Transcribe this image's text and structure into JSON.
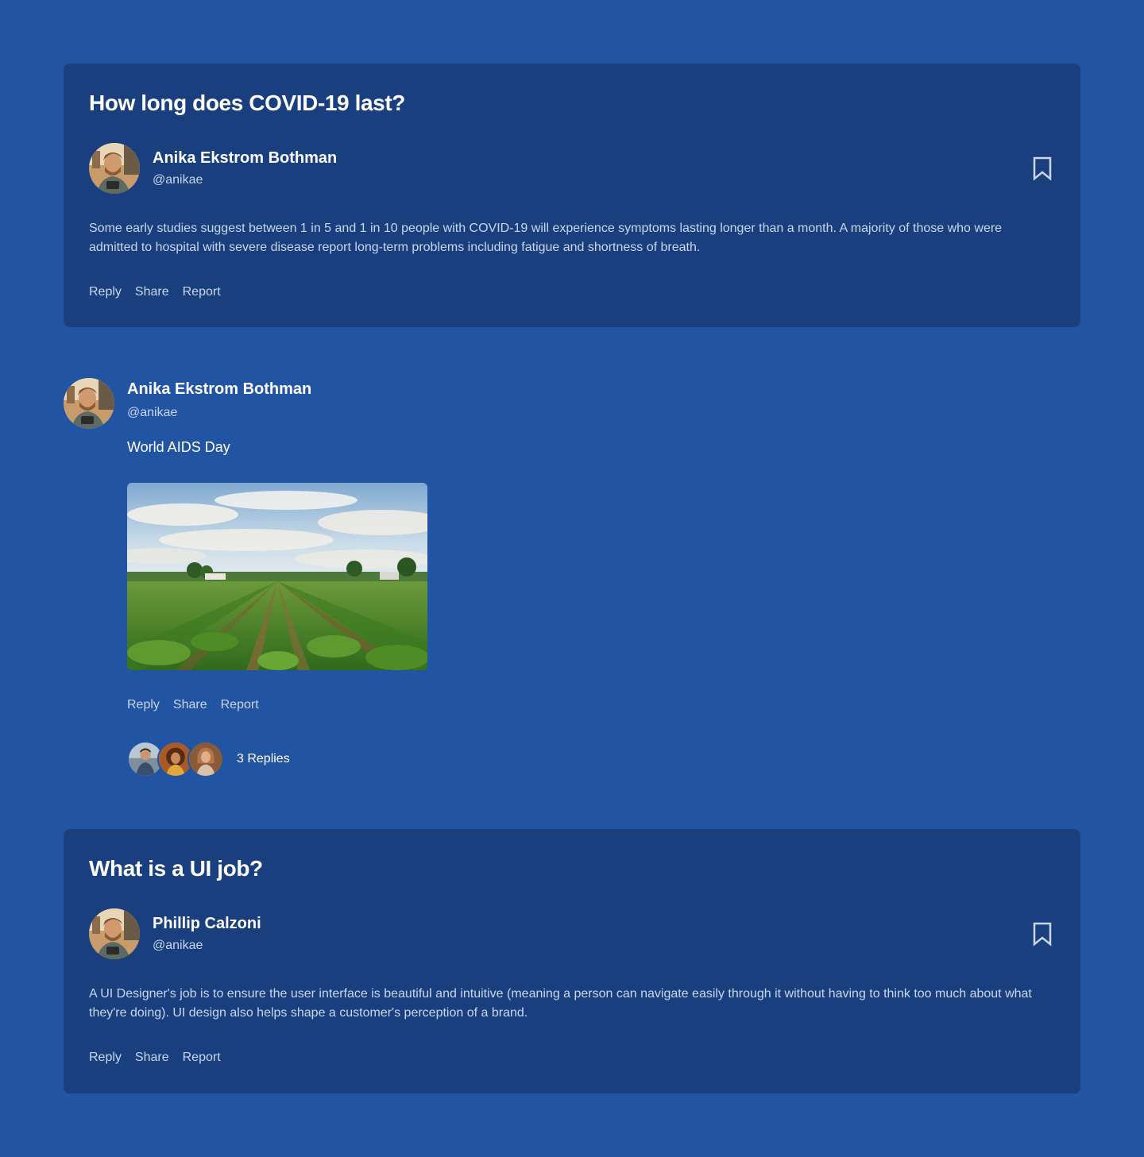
{
  "posts": [
    {
      "title": "How long does COVID-19 last?",
      "author": {
        "name": "Anika Ekstrom Bothman",
        "handle": "@anikae"
      },
      "body": "Some early studies suggest between 1 in 5 and 1 in 10 people with COVID-19 will experience symptoms lasting longer than a month. A majority of those who were admitted to hospital with severe disease report long-term problems including fatigue and shortness of breath.",
      "actions": [
        "Reply",
        "Share",
        "Report"
      ],
      "bookmark_icon": "bookmark-icon"
    },
    {
      "author": {
        "name": "Anika Ekstrom Bothman",
        "handle": "@anikae"
      },
      "text": "World AIDS Day",
      "image": "farm-field-landscape",
      "actions": [
        "Reply",
        "Share",
        "Report"
      ],
      "replies_label": "3 Replies"
    },
    {
      "title": "What is a UI job?",
      "author": {
        "name": "Phillip Calzoni",
        "handle": "@anikae"
      },
      "body": "A UI Designer's job is to ensure the user interface is beautiful and intuitive (meaning a person can navigate easily through it without having to think too much about what they're doing). UI design also helps shape a customer's perception of a brand.",
      "actions": [
        "Reply",
        "Share",
        "Report"
      ],
      "bookmark_icon": "bookmark-icon"
    }
  ],
  "colors": {
    "page_background": "#2254a4",
    "card_background": "#1a3f7e",
    "muted_text": "#c9d7ee"
  }
}
